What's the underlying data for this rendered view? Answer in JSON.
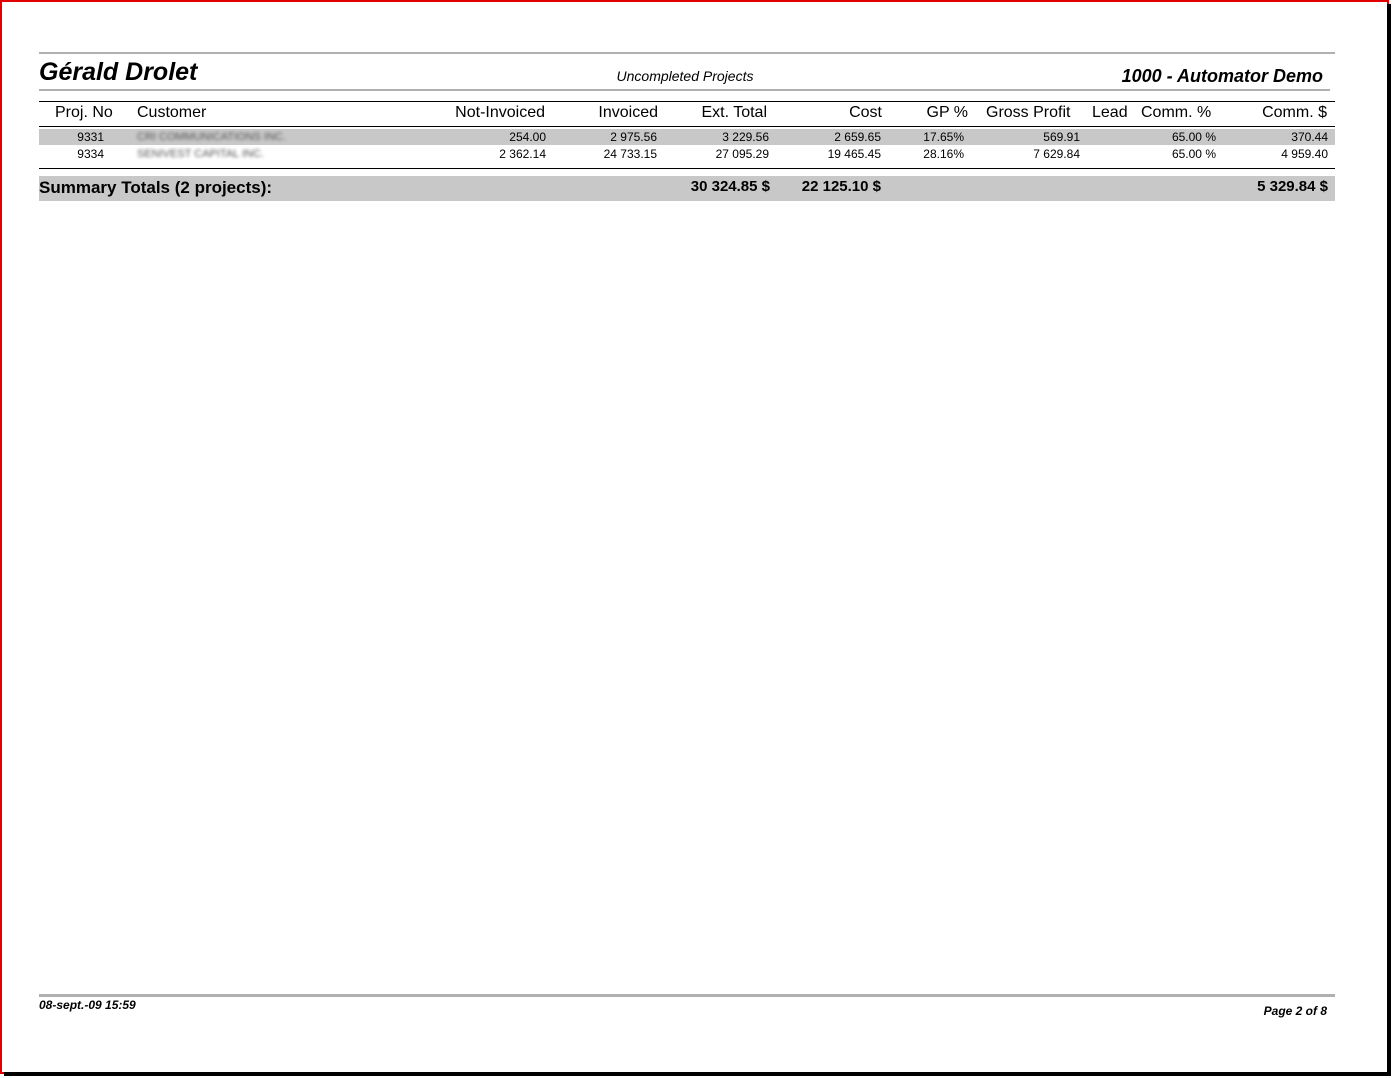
{
  "header": {
    "name": "Gérald Drolet",
    "report_title": "Uncompleted Projects",
    "company": "1000 - Automator Demo"
  },
  "columns": [
    "Proj. No",
    "Customer",
    "Not-Invoiced",
    "Invoiced",
    "Ext. Total",
    "Cost",
    "GP %",
    "Gross Profit",
    "Lead",
    "Comm. %",
    "Comm. $"
  ],
  "rows": [
    {
      "proj": "9331",
      "customer": "CRI COMMUNICATIONS INC.",
      "not_invoiced": "254.00",
      "invoiced": "2 975.56",
      "ext_total": "3 229.56",
      "cost": "2 659.65",
      "gp": "17.65%",
      "gross_profit": "569.91",
      "lead": "",
      "comm_pct": "65.00 %",
      "comm": "370.44"
    },
    {
      "proj": "9334",
      "customer": "SENIVEST CAPITAL INC.",
      "not_invoiced": "2 362.14",
      "invoiced": "24 733.15",
      "ext_total": "27 095.29",
      "cost": "19 465.45",
      "gp": "28.16%",
      "gross_profit": "7 629.84",
      "lead": "",
      "comm_pct": "65.00 %",
      "comm": "4 959.40"
    }
  ],
  "summary": {
    "label": "Summary Totals (2 projects):",
    "ext_total": "30 324.85 $",
    "cost": "22 125.10 $",
    "comm": "5 329.84 $"
  },
  "footer": {
    "datetime": "08-sept.-09  15:59",
    "page": "Page 2 of 8"
  },
  "colors": {
    "frame": "#e00000",
    "row_highlight": "#c8c8c8",
    "summary_bar": "#c8c8c8"
  }
}
